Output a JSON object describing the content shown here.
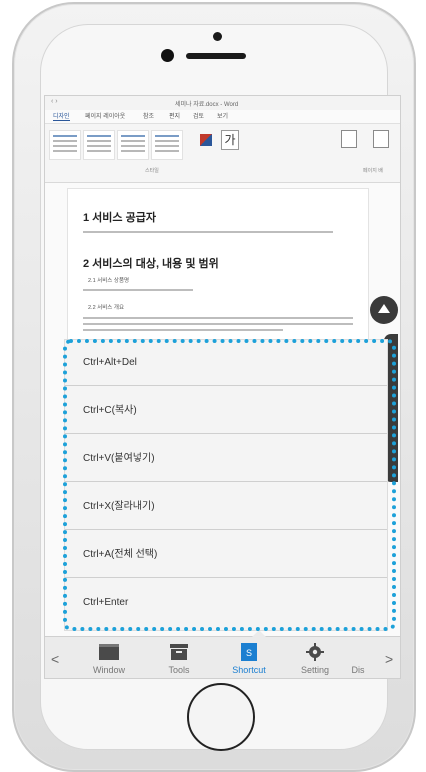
{
  "word": {
    "title": "세미나 자료.docx - Word",
    "tabs": [
      "디자인",
      "페이지 레이아웃",
      "참조",
      "편지",
      "검토",
      "보기"
    ],
    "group_styles": "스타일",
    "group_page": "페이지 배",
    "ribbon_ga": "가"
  },
  "document": {
    "heading1": "1 서비스 공급자",
    "heading2": "2 서비스의 대상, 내용 및 범위",
    "sub1": "2.1  서비스 상품명",
    "sub2": "2.2  서비스 개요"
  },
  "shortcut_list": {
    "items": [
      "Ctrl+Alt+Del",
      "Ctrl+C(복사)",
      "Ctrl+V(붙여넣기)",
      "Ctrl+X(잘라내기)",
      "Ctrl+A(전체 선택)",
      "Ctrl+Enter"
    ]
  },
  "toolbar": {
    "prev": "<",
    "next": ">",
    "items": [
      {
        "label": "Window",
        "icon": "window-icon"
      },
      {
        "label": "Tools",
        "icon": "tools-icon"
      },
      {
        "label": "Shortcut",
        "icon": "shortcut-icon"
      },
      {
        "label": "Setting",
        "icon": "gear-icon"
      },
      {
        "label": "Dis",
        "icon": "display-icon"
      }
    ],
    "active_index": 2
  },
  "colors": {
    "highlight": "#1da1d9",
    "active": "#1b7fd1"
  }
}
